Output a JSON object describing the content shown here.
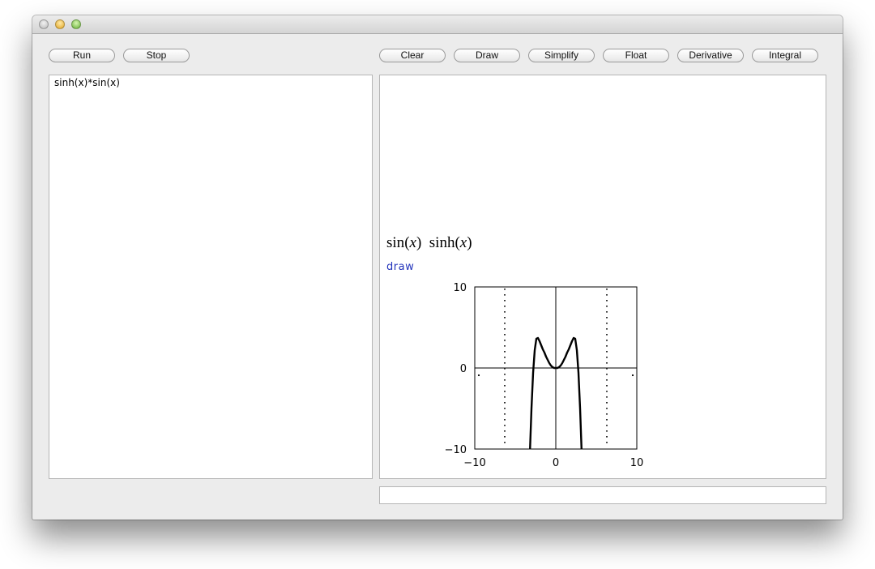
{
  "window": {
    "buttons_left": [
      "Run",
      "Stop"
    ],
    "buttons_right": [
      "Clear",
      "Draw",
      "Simplify",
      "Float",
      "Derivative",
      "Integral"
    ]
  },
  "editor": {
    "text": "sinh(x)*sin(x)"
  },
  "output": {
    "result_parts": {
      "f1": "sin",
      "v1": "x",
      "f2": "sinh",
      "v2": "x"
    },
    "command": "draw"
  },
  "status": {
    "value": ""
  },
  "chart_data": {
    "type": "line",
    "xlim": [
      -10,
      10
    ],
    "ylim": [
      -10,
      10
    ],
    "x_ticks": [
      "−10",
      "0",
      "10"
    ],
    "y_ticks": [
      "10",
      "0",
      "−10"
    ],
    "series": [
      {
        "expression": "sin(x)*sinh(x)",
        "x": [
          -3.4,
          -3.2,
          -3.0,
          -2.8,
          -2.6,
          -2.4,
          -2.2,
          -2.0,
          -1.8,
          -1.6,
          -1.4,
          -1.2,
          -1.0,
          -0.8,
          -0.6,
          -0.4,
          -0.2,
          0,
          0.2,
          0.4,
          0.6,
          0.8,
          1.0,
          1.2,
          1.4,
          1.6,
          1.8,
          2.0,
          2.2,
          2.4,
          2.6,
          2.8,
          3.0,
          3.2,
          3.4
        ],
        "y": [
          -15,
          -10.6,
          -5.0,
          -0.6,
          2.2,
          3.6,
          3.7,
          3.3,
          2.8,
          2.3,
          1.9,
          1.4,
          1.0,
          0.6,
          0.3,
          0.1,
          0.0,
          0.0,
          0.0,
          0.1,
          0.3,
          0.6,
          1.0,
          1.4,
          1.9,
          2.3,
          2.8,
          3.3,
          3.7,
          3.6,
          2.2,
          -0.6,
          -5.0,
          -10.6,
          -15
        ]
      }
    ],
    "dotted_x": [
      -6.3,
      6.3
    ],
    "stray_points": [
      [
        -9.5,
        -0.9
      ],
      [
        9.5,
        -0.9
      ]
    ]
  }
}
